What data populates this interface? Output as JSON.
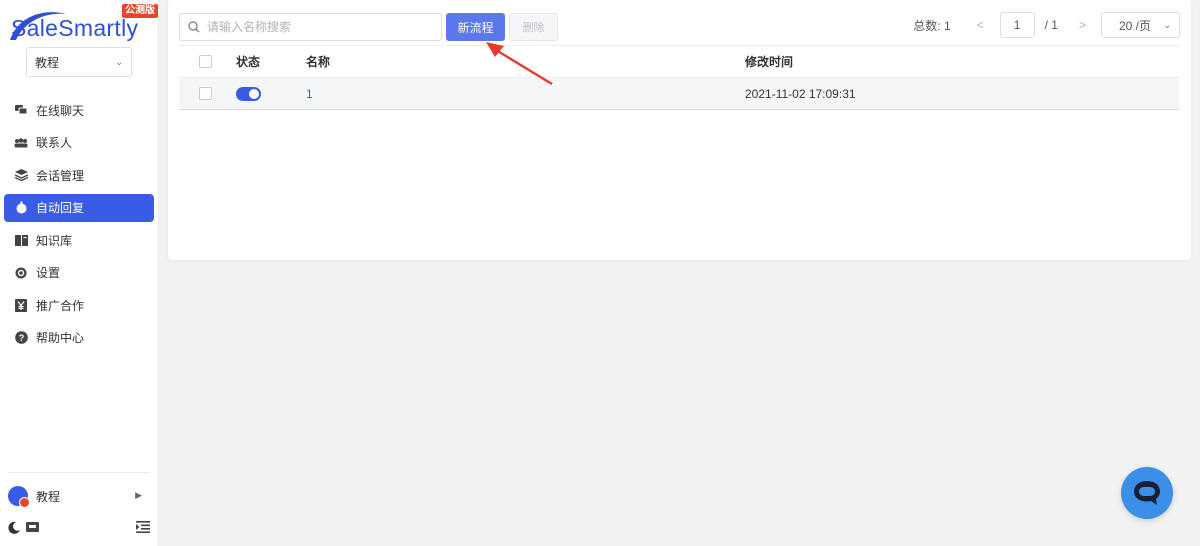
{
  "brand": {
    "name": "SaleSmartly",
    "badge": "公测版"
  },
  "workspace": {
    "selected": "教程"
  },
  "nav": [
    {
      "label": "在线聊天",
      "icon": "chat-bubbles-icon",
      "active": false
    },
    {
      "label": "联系人",
      "icon": "contacts-icon",
      "active": false
    },
    {
      "label": "会话管理",
      "icon": "layers-icon",
      "active": false
    },
    {
      "label": "自动回复",
      "icon": "auto-reply-icon",
      "active": true
    },
    {
      "label": "知识库",
      "icon": "book-icon",
      "active": false
    },
    {
      "label": "设置",
      "icon": "gear-icon",
      "active": false
    },
    {
      "label": "推广合作",
      "icon": "yen-icon",
      "active": false
    },
    {
      "label": "帮助中心",
      "icon": "help-icon",
      "active": false
    }
  ],
  "user": {
    "name": "教程"
  },
  "toolbar": {
    "search_placeholder": "请输入名称搜索",
    "new_label": "新流程",
    "delete_label": "删除"
  },
  "pagination": {
    "total_label": "总数: 1",
    "current_page": "1",
    "total_pages": "/ 1",
    "page_size": "20 /页"
  },
  "table": {
    "columns": [
      "状态",
      "名称",
      "修改时间"
    ],
    "rows": [
      {
        "enabled": true,
        "name": "1",
        "modified": "2021-11-02 17:09:31"
      }
    ]
  },
  "colors": {
    "accent": "#3a5be6",
    "primary_button": "#5b78ec",
    "badge": "#e8462b",
    "fab": "#3b8fe8",
    "annotation": "#e83a2f"
  }
}
